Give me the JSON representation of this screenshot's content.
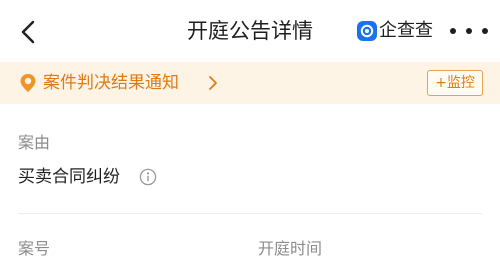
{
  "header": {
    "title": "开庭公告详情",
    "brand_name": "企查查",
    "icons": {
      "back": "chevron-left-icon",
      "brand": "qcc-logo-icon",
      "more": "more-dots-icon"
    }
  },
  "notice": {
    "text": "案件判决结果通知",
    "monitor_label": "+监控",
    "icons": {
      "location": "location-pin-icon",
      "chevron": "chevron-right-icon"
    }
  },
  "details": {
    "cause_label": "案由",
    "cause_value": "买卖合同纠纷",
    "case_number_label": "案号",
    "hearing_time_label": "开庭时间",
    "icons": {
      "info": "info-circle-icon"
    }
  },
  "colors": {
    "accent_orange": "#e07b12",
    "notice_bg": "#fdf4e6",
    "brand_blue": "#1a73e8",
    "label_gray": "#8c8c8c",
    "text_dark": "#1f1f1f"
  }
}
